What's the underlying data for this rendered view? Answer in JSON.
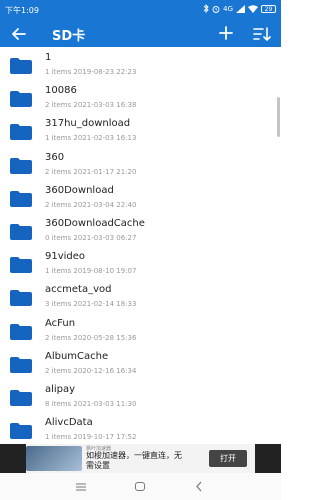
{
  "status_bar": {
    "time": "下午1:09",
    "network": "4G",
    "battery": "29"
  },
  "app_bar": {
    "title": "SD卡"
  },
  "files": [
    {
      "name": "1",
      "meta": "1 items 2019-08-23 22:23"
    },
    {
      "name": "10086",
      "meta": "2 items 2021-03-03 16:38"
    },
    {
      "name": "317hu_download",
      "meta": "1 items 2021-02-03 16:13"
    },
    {
      "name": "360",
      "meta": "2 items 2021-01-17 21:20"
    },
    {
      "name": "360Download",
      "meta": "2 items 2021-03-04 22:40"
    },
    {
      "name": "360DownloadCache",
      "meta": "0 items 2021-03-03 06:27"
    },
    {
      "name": "91video",
      "meta": "1 items 2019-08-10 19:07"
    },
    {
      "name": "accmeta_vod",
      "meta": "3 items 2021-02-14 18:33"
    },
    {
      "name": "AcFun",
      "meta": "2 items 2020-05-28 15:36"
    },
    {
      "name": "AlbumCache",
      "meta": "2 items 2020-12-16 16:34"
    },
    {
      "name": "alipay",
      "meta": "8 items 2021-03-03 11:30"
    },
    {
      "name": "AlivcData",
      "meta": "1 items 2019-10-17 17:52"
    }
  ],
  "ad": {
    "brand": "枫叶加速器",
    "text": "如梭加速器，一键直连，无需设置",
    "open_label": "打开"
  },
  "colors": {
    "primary": "#1976d2",
    "folder": "#1565c0"
  }
}
